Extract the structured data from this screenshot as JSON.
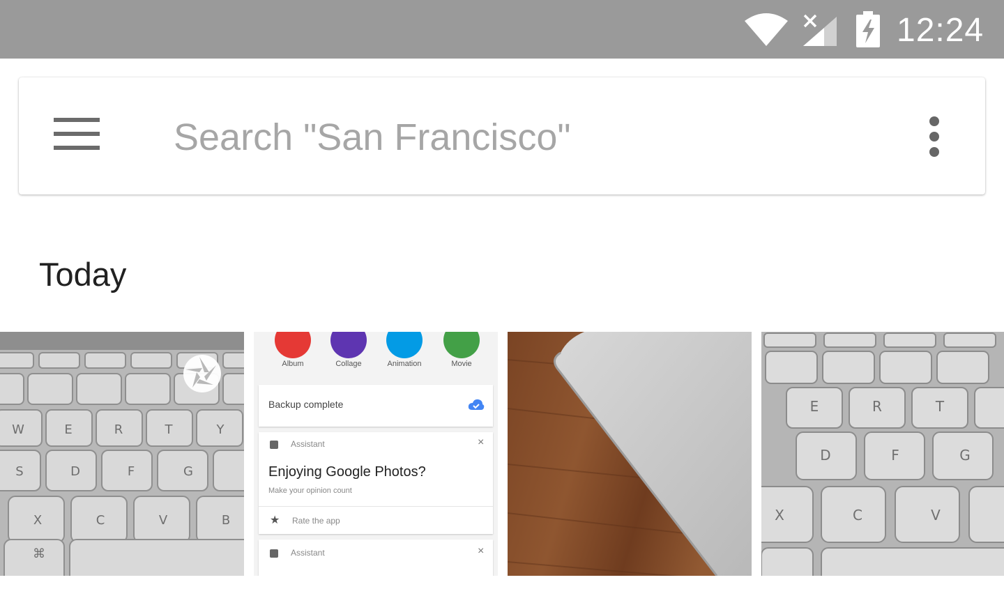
{
  "status_bar": {
    "time": "12:24",
    "icons": [
      "wifi-icon",
      "signal-no-sim-icon",
      "battery-charging-icon"
    ]
  },
  "search": {
    "placeholder": "Search \"San Francisco\"",
    "menu_icon": "hamburger-menu-icon",
    "overflow_icon": "more-vertical-icon"
  },
  "section": {
    "title": "Today"
  },
  "photos": [
    {
      "kind": "keyboard",
      "badge_icon": "camera-aperture-icon",
      "keys": [
        "W",
        "E",
        "R",
        "T",
        "Y",
        "S",
        "D",
        "F",
        "G",
        "X",
        "C",
        "V",
        "B",
        "⌘"
      ]
    },
    {
      "kind": "screenshot",
      "fabs": [
        {
          "label": "Album",
          "color": "#e53935"
        },
        {
          "label": "Collage",
          "color": "#5e35b1"
        },
        {
          "label": "Animation",
          "color": "#039be5"
        },
        {
          "label": "Movie",
          "color": "#43a047"
        }
      ],
      "backup_text": "Backup complete",
      "assistant_label": "Assistant",
      "prompt_title": "Enjoying Google Photos?",
      "prompt_subtitle": "Make your opinion count",
      "rate_text": "Rate the app",
      "assistant_label_2": "Assistant"
    },
    {
      "kind": "trackpad-on-wood"
    },
    {
      "kind": "keyboard-closeup",
      "keys": [
        "E",
        "R",
        "T",
        "D",
        "F",
        "G",
        "X",
        "C",
        "V"
      ]
    }
  ],
  "colors": {
    "status_bar": "#9a9a9a",
    "accent_blue": "#4285f4"
  }
}
